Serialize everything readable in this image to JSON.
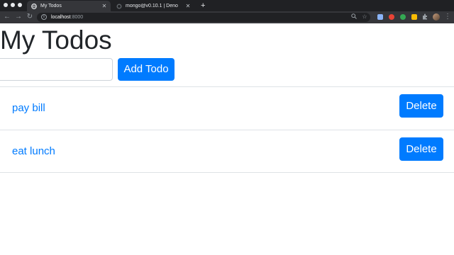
{
  "browser": {
    "tabs": [
      {
        "title": "My Todos",
        "active": true,
        "favicon": "globe-icon"
      },
      {
        "title": "mongo@v0.10.1 | Deno",
        "active": false,
        "favicon": "deno-icon"
      }
    ],
    "new_tab_glyph": "+",
    "address": {
      "host": "localhost",
      "port": ":8000"
    },
    "extension_colors": [
      "#8ab4f8",
      "#ea4335",
      "#34a853",
      "#fbbc04"
    ]
  },
  "page": {
    "title": "My Todos",
    "input": {
      "value": "",
      "placeholder": ""
    },
    "add_button": "Add Todo",
    "todos": [
      {
        "text": "pay bill",
        "delete_label": "Delete"
      },
      {
        "text": "eat lunch",
        "delete_label": "Delete"
      }
    ]
  },
  "colors": {
    "primary": "#007bff",
    "heading": "#212529"
  }
}
